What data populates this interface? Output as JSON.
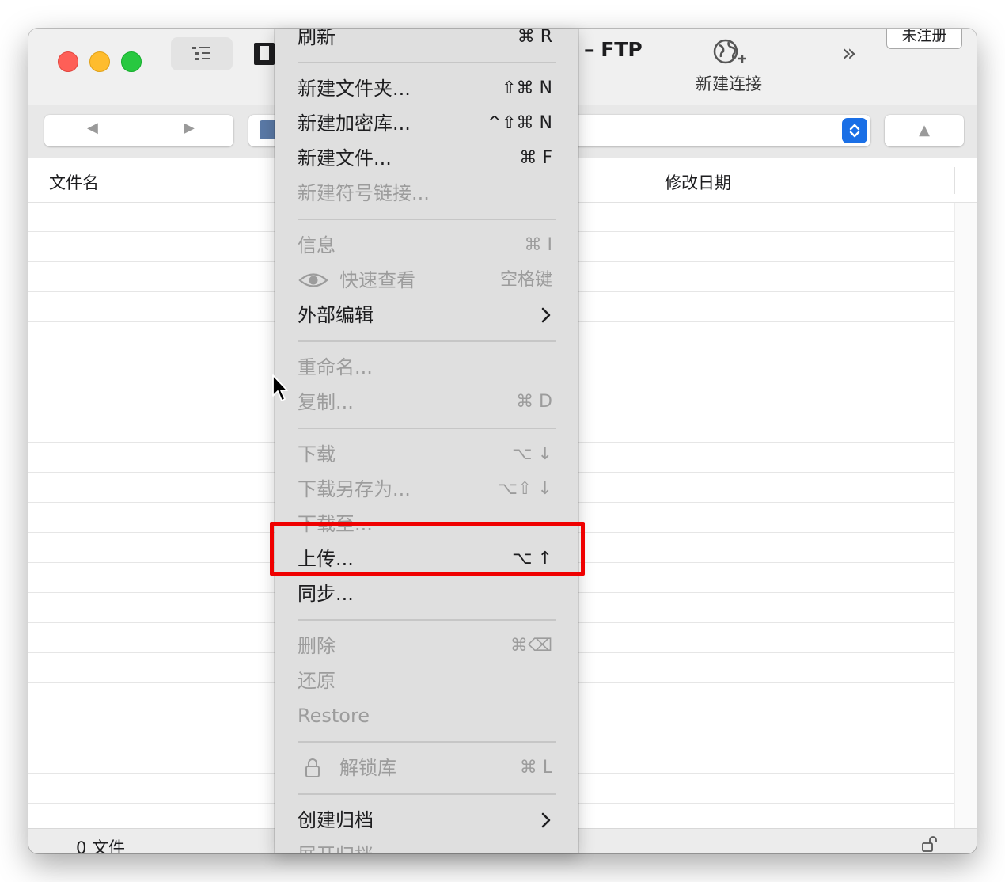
{
  "window": {
    "title": "– FTP",
    "traffic_lights": [
      "close",
      "minimize",
      "maximize"
    ],
    "colors": {
      "close": "#fe5f57",
      "minimize": "#febc2e",
      "maximize": "#28c840",
      "accent": "#1a6fe6",
      "highlight": "#ef0000"
    }
  },
  "toolbar": {
    "new_connection_label": "新建连接",
    "unregistered_label": "未注册",
    "back_glyph": "◀",
    "forward_glyph": "▶",
    "up_glyph": "▲",
    "more_glyph": "»"
  },
  "table": {
    "columns": [
      "文件名",
      "修改日期"
    ],
    "rows": []
  },
  "status": {
    "file_count": "0 文件"
  },
  "context_menu": {
    "items": [
      {
        "label": "刷新",
        "shortcut": "⌘ R",
        "enabled": true
      },
      {
        "label": "新建文件夹...",
        "shortcut": "⇧⌘ N",
        "enabled": true
      },
      {
        "label": "新建加密库...",
        "shortcut": "^⇧⌘ N",
        "enabled": true
      },
      {
        "label": "新建文件...",
        "shortcut": "⌘ F",
        "enabled": true
      },
      {
        "label": "新建符号链接...",
        "shortcut": "",
        "enabled": false
      },
      {
        "label": "信息",
        "shortcut": "⌘ I",
        "enabled": false
      },
      {
        "label": "快速查看",
        "shortcut": "空格键",
        "enabled": false,
        "icon": "eye-icon"
      },
      {
        "label": "外部编辑",
        "shortcut": "",
        "enabled": true,
        "submenu": true
      },
      {
        "label": "重命名...",
        "shortcut": "",
        "enabled": false
      },
      {
        "label": "复制...",
        "shortcut": "⌘ D",
        "enabled": false
      },
      {
        "label": "下载",
        "shortcut": "⌥ ↓",
        "enabled": false
      },
      {
        "label": "下载另存为...",
        "shortcut": "⌥⇧ ↓",
        "enabled": false
      },
      {
        "label": "下载至...",
        "shortcut": "",
        "enabled": false
      },
      {
        "label": "上传...",
        "shortcut": "⌥ ↑",
        "enabled": true,
        "highlighted": true
      },
      {
        "label": "同步...",
        "shortcut": "",
        "enabled": true
      },
      {
        "label": "删除",
        "shortcut": "⌘⌫",
        "enabled": false
      },
      {
        "label": "还原",
        "shortcut": "",
        "enabled": false
      },
      {
        "label": "Restore",
        "shortcut": "",
        "enabled": false
      },
      {
        "label": "解锁库",
        "shortcut": "⌘ L",
        "enabled": false,
        "icon": "lock-icon"
      },
      {
        "label": "创建归档",
        "shortcut": "",
        "enabled": true,
        "submenu": true
      },
      {
        "label": "展开归档",
        "shortcut": "",
        "enabled": false
      }
    ]
  }
}
